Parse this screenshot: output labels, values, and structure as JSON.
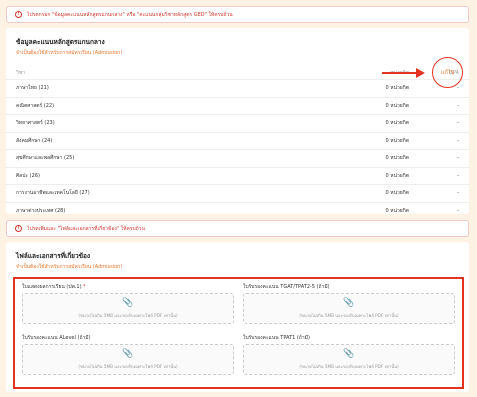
{
  "alert_top": {
    "text": "ไปรดกรอก \"ข้อมูลคะแนนหลักสูตรแกนกลาง\" หรือ \"คะแนนกลุ่มวิชาหลักสูตร GED\" ให้ครบถ้วน"
  },
  "core": {
    "title": "ข้อมูลคะแนนหลักสูตรแกนกลาง",
    "subtitle": "จำเป็นต้องใช้สำหรับการสมัครเรียน (Admission)",
    "edit_label": "แก้ไข",
    "headers": {
      "subject": "วิชา",
      "credit": "หน่วยกิต",
      "gpa": "GPA"
    },
    "rows": [
      {
        "subject": "ภาษาไทย (21)",
        "credit": "0 หน่วยกิต",
        "gpa": "-"
      },
      {
        "subject": "คณิตศาสตร์ (22)",
        "credit": "0 หน่วยกิต",
        "gpa": "-"
      },
      {
        "subject": "วิทยาศาสตร์ (23)",
        "credit": "0 หน่วยกิต",
        "gpa": "-"
      },
      {
        "subject": "สังคมศึกษา (24)",
        "credit": "0 หน่วยกิต",
        "gpa": "-"
      },
      {
        "subject": "สุขศึกษาและพลศึกษา (25)",
        "credit": "0 หน่วยกิต",
        "gpa": "-"
      },
      {
        "subject": "ศิลปะ (26)",
        "credit": "0 หน่วยกิต",
        "gpa": "-"
      },
      {
        "subject": "การงานอาชีพและเทคโนโลยี (27)",
        "credit": "0 หน่วยกิต",
        "gpa": "-"
      },
      {
        "subject": "ภาษาต่างประเทศ (28)",
        "credit": "0 หน่วยกิต",
        "gpa": "-"
      }
    ]
  },
  "alert_docs": {
    "text": "ไปรดเพิ่มและ \"ไฟล์และเอกสารที่เกี่ยวข้อง\" ให้ครบถ้วน"
  },
  "docs": {
    "title": "ไฟล์และเอกสารที่เกี่ยวข้อง",
    "subtitle": "จำเป็นต้องใช้สำหรับการสมัครเรียน (Admission)",
    "uploads": [
      {
        "label": "ใบแสดงผลการเรียน (ปพ.1)",
        "required": "*",
        "hint": "(ขนาดไม่เกิน 5MB และรองรับเฉพาะไฟล์ PDF เท่านั้น)"
      },
      {
        "label": "ใบรับรองคะแนน TGAT/TPAT2-5 (ถ้ามี)",
        "required": "",
        "hint": "(ขนาดไม่เกิน 5MB และรองรับเฉพาะไฟล์ PDF เท่านั้น)"
      },
      {
        "label": "ใบรับรองคะแนน ALevel (ถ้ามี)",
        "required": "",
        "hint": "(ขนาดไม่เกิน 5MB และรองรับเฉพาะไฟล์ PDF เท่านั้น)"
      },
      {
        "label": "ใบรับรองคะแนน TPAT1 (ถ้ามี)",
        "required": "",
        "hint": "(ขนาดไม่เกิน 5MB และรองรับเฉพาะไฟล์ PDF เท่านั้น)"
      }
    ]
  },
  "icons": {
    "alert": "alert-circle-icon",
    "attach": "paperclip-icon"
  },
  "colors": {
    "accent": "#e8752a",
    "danger": "#d0342c",
    "annotation": "#e53323",
    "background": "#fdf2e3"
  }
}
